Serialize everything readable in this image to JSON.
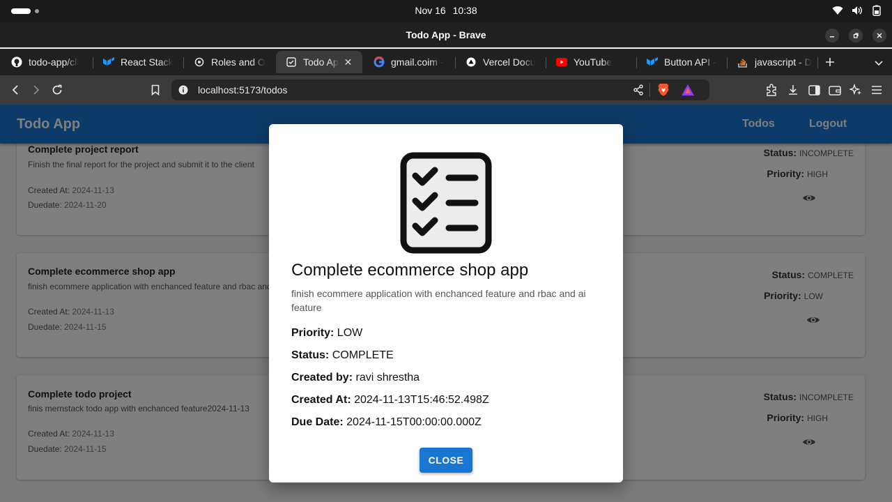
{
  "os": {
    "date": "Nov 16",
    "time": "10:38"
  },
  "window": {
    "title": "Todo App - Brave"
  },
  "tabs": [
    {
      "label": "todo-app/cli",
      "icon": "github-icon"
    },
    {
      "label": "React Stack",
      "icon": "mui-icon"
    },
    {
      "label": "Roles and O",
      "icon": "openai-icon"
    },
    {
      "label": "Todo Ap",
      "icon": "todo-icon",
      "active": true
    },
    {
      "label": "gmail.coim -",
      "icon": "google-icon"
    },
    {
      "label": "Vercel Docu",
      "icon": "vercel-icon"
    },
    {
      "label": "YouTube",
      "icon": "youtube-icon"
    },
    {
      "label": "Button API -",
      "icon": "mui-icon"
    },
    {
      "label": "javascript - D",
      "icon": "stackoverflow-icon"
    }
  ],
  "address": {
    "url": "localhost:5173/todos"
  },
  "app": {
    "brand": "Todo App",
    "nav": {
      "todos": "Todos",
      "logout": "Logout"
    },
    "labels": {
      "created_at": "Created At:",
      "duedate": "Duedate:",
      "status": "Status:",
      "priority": "Priority:"
    },
    "todos": [
      {
        "title": "Complete project report",
        "description": "Finish the final report for the project and submit it to the client",
        "created_at": "2024-11-13",
        "duedate": "2024-11-20",
        "status": "INCOMPLETE",
        "priority": "HIGH"
      },
      {
        "title": "Complete ecommerce shop app",
        "description": "finish ecommere application with enchanced feature and rbac and ai feature",
        "created_at": "2024-11-13",
        "duedate": "2024-11-15",
        "status": "COMPLETE",
        "priority": "LOW"
      },
      {
        "title": "Complete todo project",
        "description": "finis mernstack todo app with enchanced feature2024-11-13",
        "created_at": "2024-11-13",
        "duedate": "2024-11-15",
        "status": "INCOMPLETE",
        "priority": "HIGH"
      }
    ]
  },
  "modal": {
    "title": "Complete ecommerce shop app",
    "description": "finish ecommere application with enchanced feature and rbac and ai feature",
    "priority_label": "Priority:",
    "priority": "LOW",
    "status_label": "Status:",
    "status": "COMPLETE",
    "created_by_label": "Created by:",
    "created_by": "ravi shrestha",
    "created_at_label": "Created At:",
    "created_at": "2024-11-13T15:46:52.498Z",
    "due_date_label": "Due Date:",
    "due_date": "2024-11-15T00:00:00.000Z",
    "close_label": "CLOSE"
  },
  "colors": {
    "primary": "#1976d2",
    "os_bar": "#1a1a1a",
    "tab_strip": "#202020",
    "toolbar": "#3b3b3b"
  }
}
